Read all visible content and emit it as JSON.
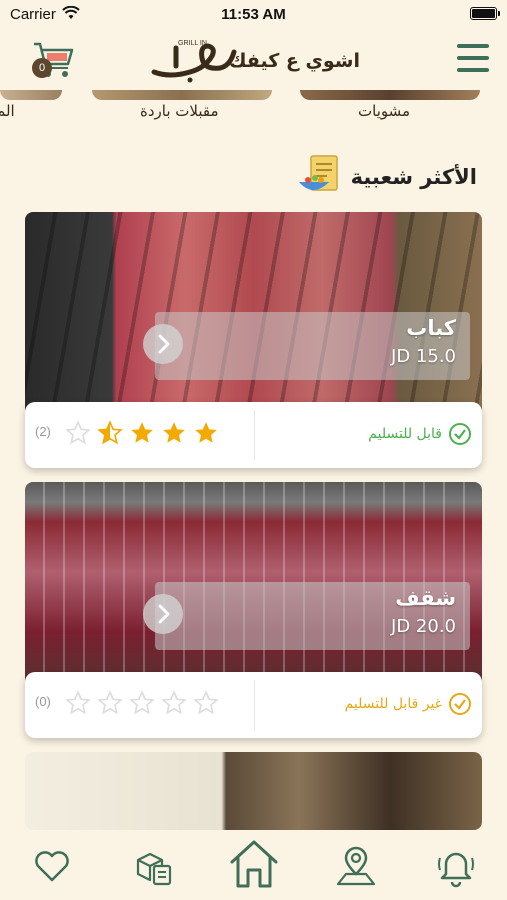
{
  "status_bar": {
    "carrier": "Carrier",
    "time": "11:53 AM"
  },
  "header": {
    "logo_text": "اشوي ع كيفك",
    "logo_sub": "GRILL IN",
    "cart_count": "0"
  },
  "categories": [
    {
      "label": "مشويات"
    },
    {
      "label": "مقبلات باردة"
    },
    {
      "label": "الم"
    }
  ],
  "section": {
    "title": "الأكثر شعبية"
  },
  "products": [
    {
      "name": "كباب",
      "price": "JD 15.0",
      "delivery": "قابل للتسليم",
      "delivery_color": "#4caf50",
      "rating": 3.5,
      "rating_count": "(2)"
    },
    {
      "name": "شقف",
      "price": "JD 20.0",
      "delivery": "غير قابل للتسليم",
      "delivery_color": "#e6a817",
      "rating": 0,
      "rating_count": "(0)"
    }
  ],
  "colors": {
    "accent_green": "#3f6f58",
    "brown": "#5c4630",
    "star": "#f2a900",
    "background": "#fbf3e3"
  },
  "tabbar": {
    "items": [
      "heart-icon",
      "order-list-icon",
      "home-icon",
      "location-icon",
      "bell-icon"
    ]
  }
}
